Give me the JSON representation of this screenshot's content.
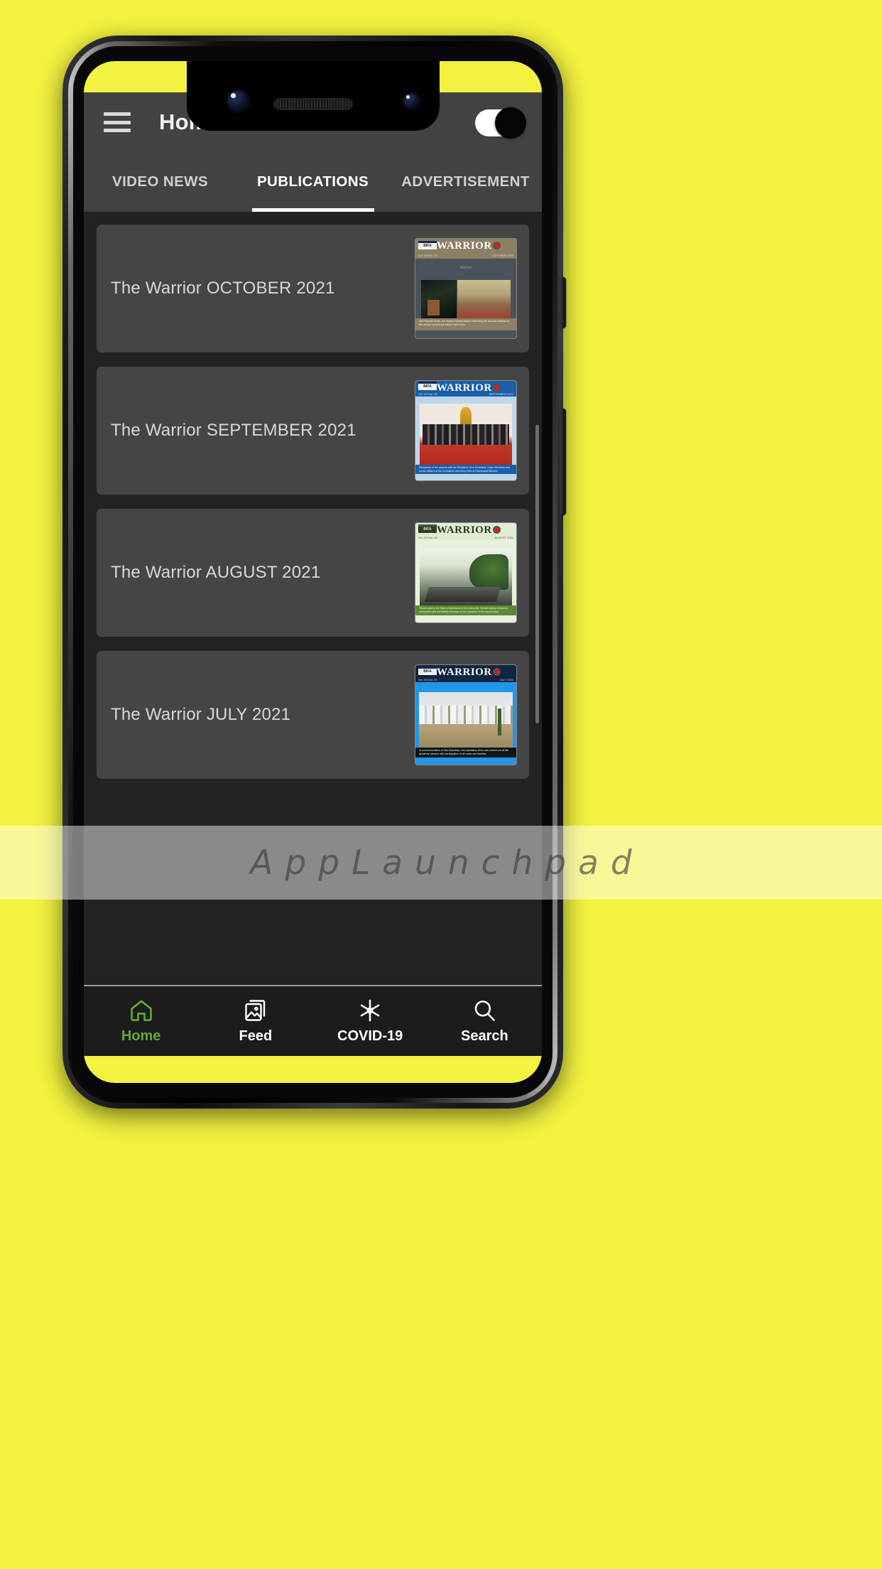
{
  "background": {
    "color": "#f2f23f"
  },
  "app_bar": {
    "menu_icon": "hamburger-menu-icon",
    "title": "Home",
    "theme_toggle": {
      "state": "on",
      "track_color": "#ffffff",
      "thumb_color": "#050505"
    }
  },
  "tabs": [
    {
      "label": "VIDEO NEWS",
      "active": false
    },
    {
      "label": "PUBLICATIONS",
      "active": true
    },
    {
      "label": "ADVERTISEMENT",
      "active": false
    }
  ],
  "publications": [
    {
      "title": "The Warrior OCTOBER 2021",
      "cover": {
        "masthead": "WARRIOR",
        "brand": "BIFA",
        "issue_line": "Vol. XIII  No. 10",
        "date_line": "OCTOBER 2021",
        "tagline": "Warrior",
        "caption": "Shri Rajnath Singh, the Honble Raksha Mantri delivering the keynote address at the annual conference held in New Delhi",
        "accent_color": "#8d7f63",
        "body_color": "#4a535c"
      }
    },
    {
      "title": "The Warrior SEPTEMBER 2021",
      "cover": {
        "masthead": "WARRIOR",
        "brand": "BIFA",
        "issue_line": "Vol. XIII  No. 09",
        "date_line": "SEPTEMBER 2021",
        "caption": "Recipients of the awards with the President, Vice President, Union Ministers and senior officers at the investiture ceremony held at Rashtrapati Bhavan",
        "accent_color": "#1a5fa8",
        "body_color": "#bcd6ec"
      }
    },
    {
      "title": "The Warrior AUGUST 2021",
      "cover": {
        "masthead": "WARRIOR",
        "brand": "BIFA",
        "issue_line": "Vol. XIII  No. 08",
        "date_line": "AUGUST 2021",
        "caption": "Tribute paid to the fallen bravehearts at the memorial. Wreath laying ceremony conducted with full military honours on the occasion of the anniversary.",
        "accent_color": "#5b8a33",
        "body_color": "#e9f0de"
      }
    },
    {
      "title": "The Warrior JULY 2021",
      "cover": {
        "masthead": "WARRIOR",
        "brand": "BIFA",
        "issue_line": "Vol. XIII  No. 07",
        "date_line": "JULY 2021",
        "caption": "In commemoration of Van Mahotsav, tree plantation drive was carried out at the academy campus with participation of all ranks and families.",
        "accent_color": "#2196e8",
        "body_color": "#2196e8"
      }
    }
  ],
  "bottom_nav": [
    {
      "label": "Home",
      "icon": "home-icon",
      "active": true,
      "color": "#5faa2e"
    },
    {
      "label": "Feed",
      "icon": "photo-stack-icon",
      "active": false,
      "color": "#ffffff"
    },
    {
      "label": "COVID-19",
      "icon": "asterisk-virus-icon",
      "active": false,
      "color": "#ffffff"
    },
    {
      "label": "Search",
      "icon": "magnifier-icon",
      "active": false,
      "color": "#ffffff"
    }
  ],
  "watermark": {
    "text": "AppLaunchpad"
  }
}
